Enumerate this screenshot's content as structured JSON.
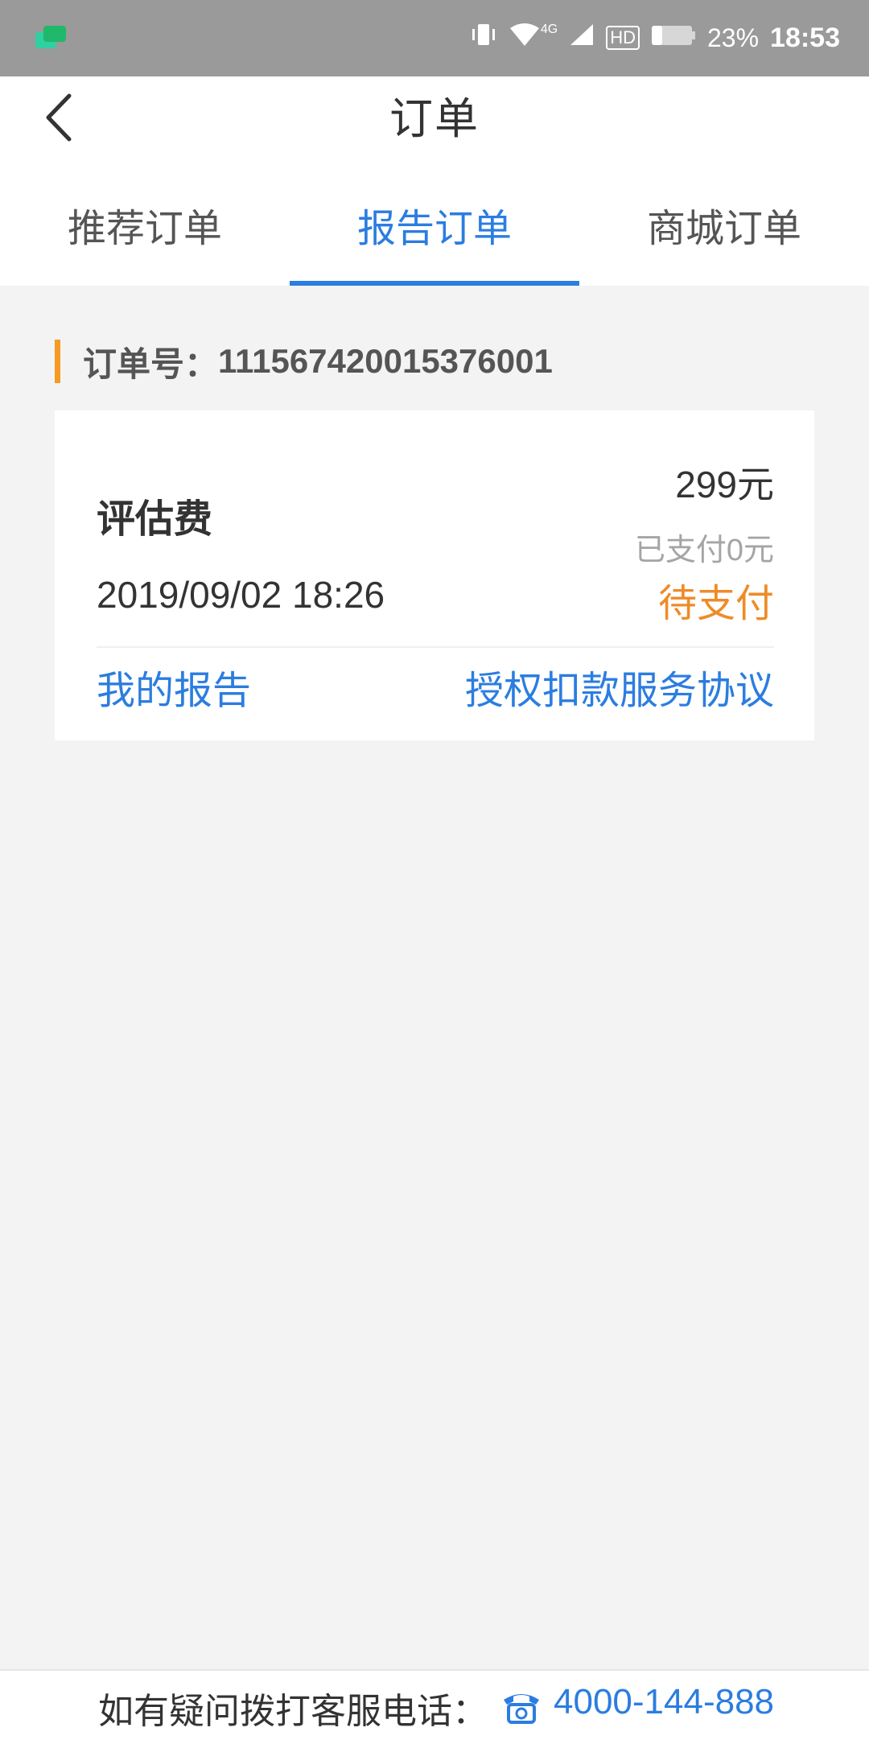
{
  "status_bar": {
    "network": "4G",
    "hd": "HD",
    "battery": "23%",
    "time": "18:53"
  },
  "header": {
    "title": "订单",
    "tabs": [
      {
        "label": "推荐订单",
        "active": false
      },
      {
        "label": "报告订单",
        "active": true
      },
      {
        "label": "商城订单",
        "active": false
      }
    ]
  },
  "order": {
    "number_label": "订单号：",
    "number_value": "111567420015376001",
    "item_name": "评估费",
    "amount": "299元",
    "paid": "已支付0元",
    "datetime": "2019/09/02 18:26",
    "status": "待支付",
    "link_report": "我的报告",
    "link_agreement": "授权扣款服务协议"
  },
  "footer": {
    "text": "如有疑问拨打客服电话：",
    "phone": "4000-144-888"
  },
  "colors": {
    "accent_blue": "#2b7de0",
    "status_orange": "#ef8b27",
    "order_accent": "#f59a23"
  },
  "icons": {
    "back": "chevron-left-icon",
    "phone": "telephone-icon"
  }
}
